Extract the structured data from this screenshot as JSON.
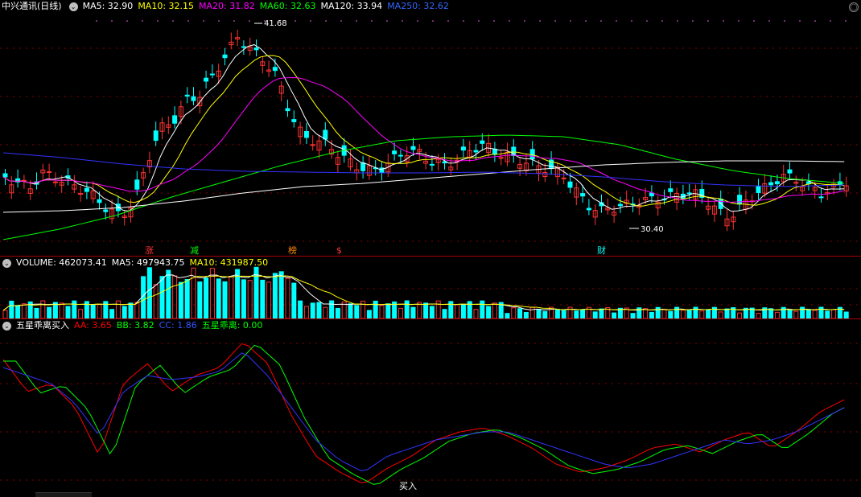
{
  "main_panel": {
    "stock_name": "中兴通讯(日线)",
    "indicators": [
      {
        "label": "MA5: 32.90",
        "color": "#ffffff"
      },
      {
        "label": "MA10: 32.15",
        "color": "#ffff00"
      },
      {
        "label": "MA20: 31.82",
        "color": "#ff00ff"
      },
      {
        "label": "MA60: 32.63",
        "color": "#00ff00"
      },
      {
        "label": "MA120: 33.94",
        "color": "#ffffff"
      },
      {
        "label": "MA250: 32.62",
        "color": "#0000ff"
      }
    ],
    "high_label": "41.68",
    "low_label": "30.40",
    "markers": [
      {
        "text": "涨",
        "color": "#ff3333"
      },
      {
        "text": "减",
        "color": "#00ff00"
      },
      {
        "text": "榜",
        "color": "#ff8800"
      },
      {
        "text": "$",
        "color": "#ff3333"
      },
      {
        "text": "财",
        "color": "#00ffff"
      }
    ]
  },
  "volume_panel": {
    "labels": [
      {
        "label": "VOLUME: 462073.41",
        "color": "#ffffff"
      },
      {
        "label": "MA5: 497943.75",
        "color": "#ffffff"
      },
      {
        "label": "MA10: 431987.50",
        "color": "#ffff00"
      }
    ]
  },
  "indicator_panel": {
    "title": "五星乖离买入",
    "labels": [
      {
        "label": "AA: 3.65",
        "color": "#ff0000"
      },
      {
        "label": "BB: 3.82",
        "color": "#00ff00"
      },
      {
        "label": "CC: 1.86",
        "color": "#0000ff"
      },
      {
        "label": "五星乖离: 0.00",
        "color": "#00ff00"
      }
    ],
    "buy_label": "买入"
  },
  "colors": {
    "up": "#ff3333",
    "down": "#00ffff",
    "grid": "#8b0000"
  }
}
